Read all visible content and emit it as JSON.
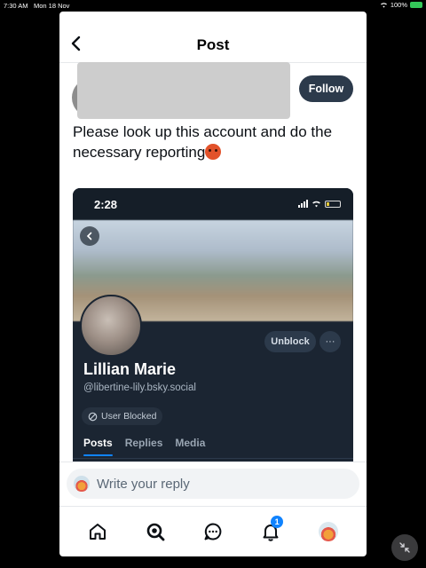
{
  "status_bar": {
    "time": "7:30 AM",
    "date": "Mon 18 Nov",
    "battery": "100%"
  },
  "header": {
    "title": "Post"
  },
  "post": {
    "follow_label": "Follow",
    "text": "Please look up this account and do the necessary reporting"
  },
  "embed": {
    "time": "2:28",
    "unblock_label": "Unblock",
    "more_label": "···",
    "name": "Lillian Marie",
    "handle": "@libertine-lily.bsky.social",
    "blocked_label": "User Blocked",
    "tabs": [
      "Posts",
      "Replies",
      "Media"
    ]
  },
  "reply": {
    "placeholder": "Write your reply"
  },
  "nav": {
    "notifications_count": "1"
  },
  "colors": {
    "accent": "#1083fe",
    "follow_bg": "#2c3a4b",
    "embed_bg": "#1b2532"
  }
}
